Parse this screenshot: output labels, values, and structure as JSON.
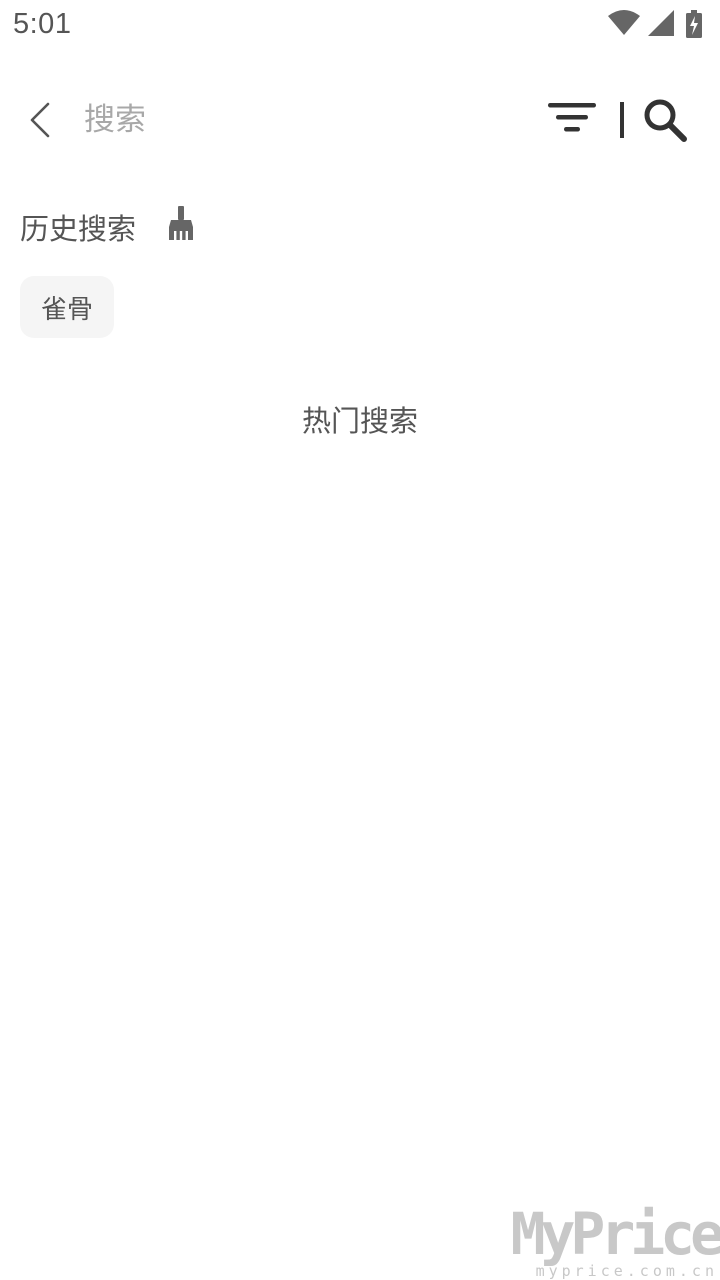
{
  "status_bar": {
    "time": "5:01",
    "icons": [
      "wifi-icon",
      "cellular-signal-icon",
      "battery-charging-icon"
    ]
  },
  "search_bar": {
    "placeholder": "搜索",
    "value": "",
    "icons": [
      "back-arrow-icon",
      "filter-icon",
      "search-icon"
    ]
  },
  "history": {
    "title": "历史搜索",
    "clear_icon": "broom-icon",
    "items": [
      "雀骨"
    ]
  },
  "hot": {
    "title": "热门搜索"
  },
  "watermark": {
    "text": "MyPrice",
    "sub": "myprice.com.cn"
  },
  "colors": {
    "text": "#555555",
    "placeholder": "#a8a8a8",
    "icon_dark": "#333333",
    "chip_bg": "#f5f5f5",
    "watermark": "#c8c8c8"
  }
}
